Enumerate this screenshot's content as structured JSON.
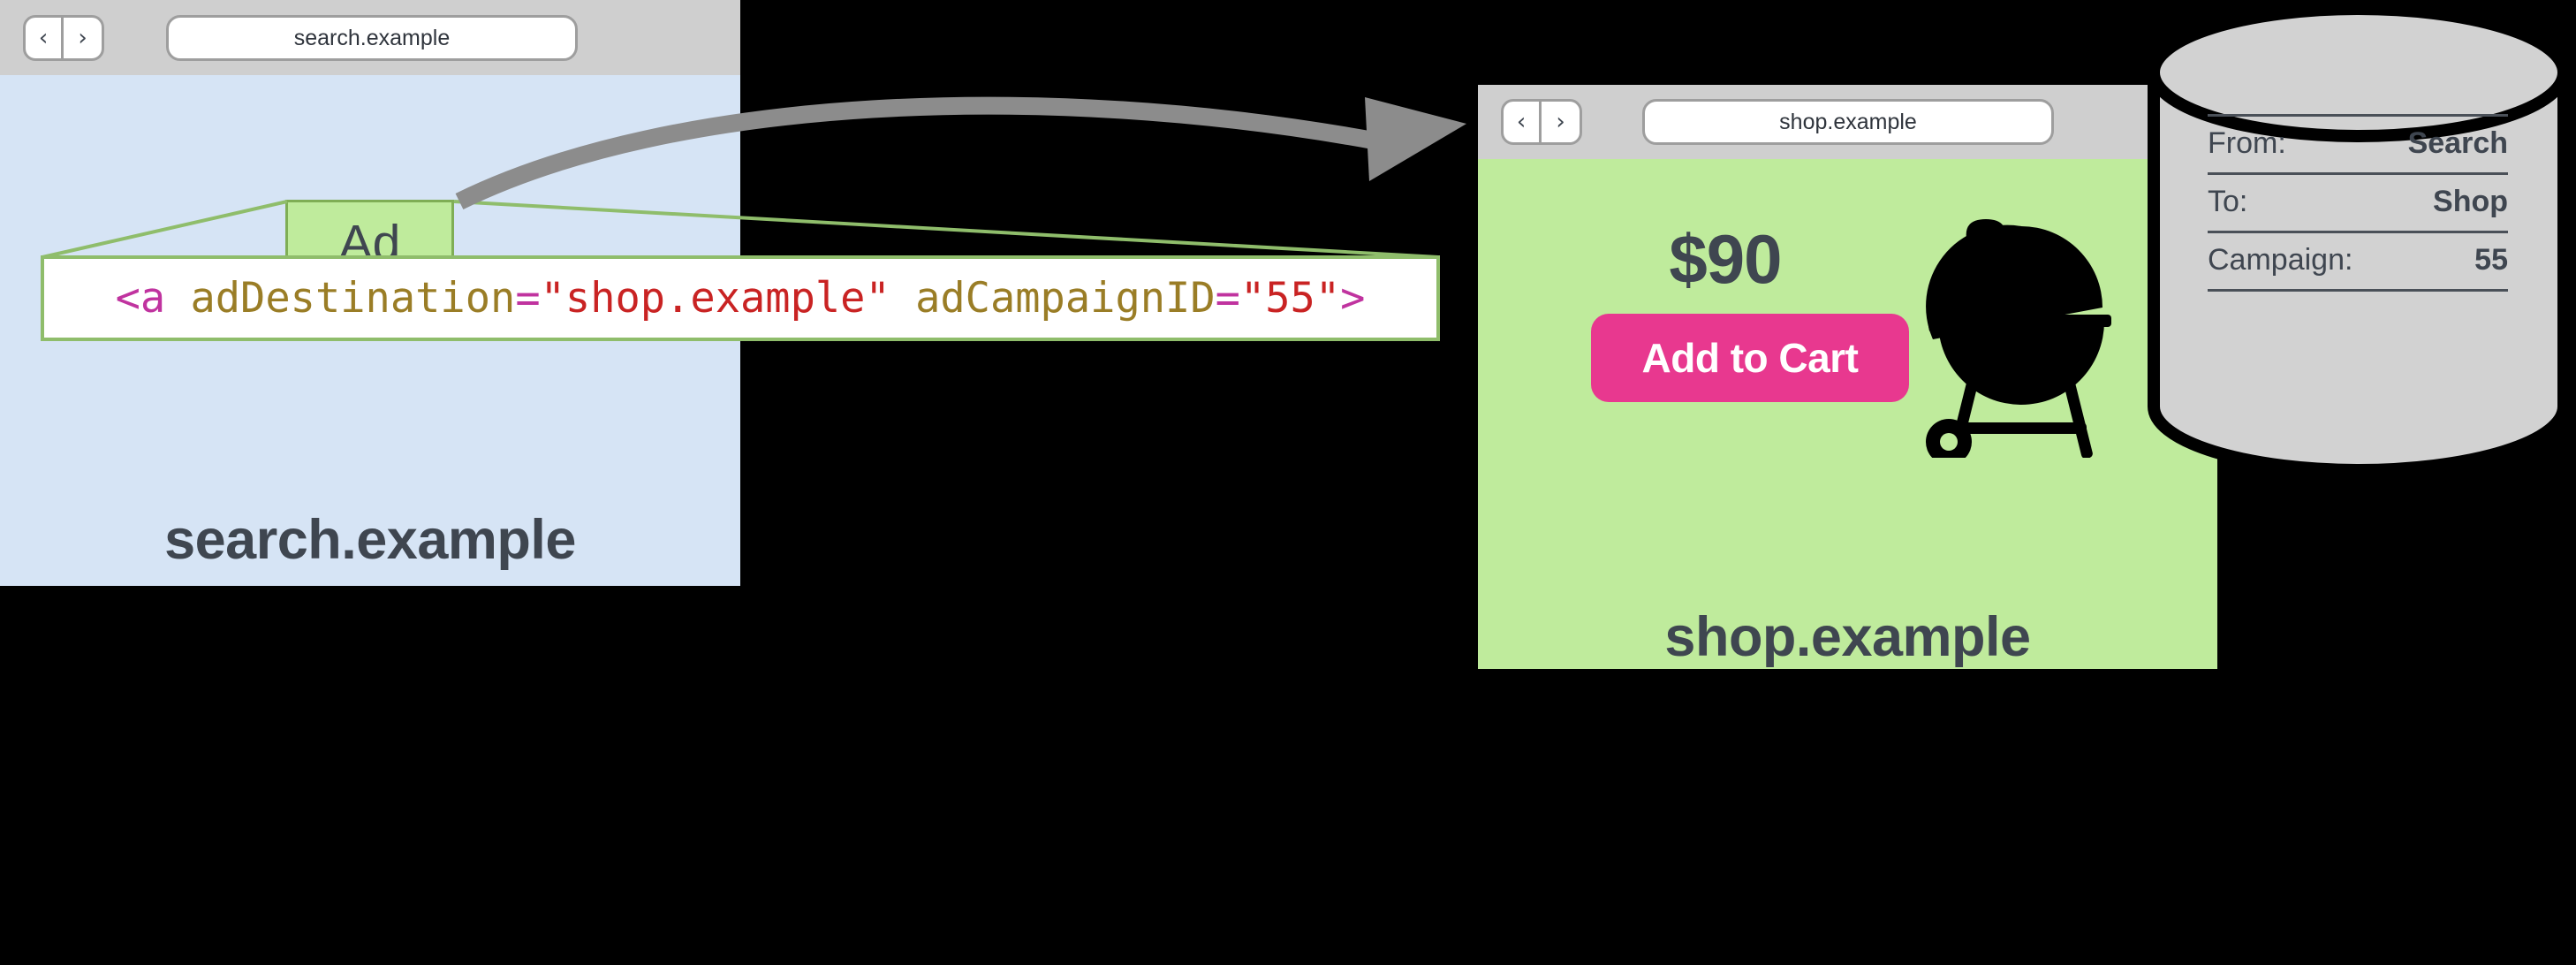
{
  "colors": {
    "page_background": "#000000",
    "chrome_gray": "#cfcfcf",
    "search_page_blue": "#d6e4f5",
    "shop_page_green": "#bfeb9c",
    "ad_green_fill": "#bfeb9c",
    "ad_green_stroke": "#7fae55",
    "callout_line_green": "#8fbd6b",
    "cart_button_pink": "#e8388f",
    "text_dark": "#3f4650",
    "arrow_gray": "#8c8c8c",
    "database_fill": "#d2d2d2",
    "code_tag": "#c0339f",
    "code_attr": "#9a7d26",
    "code_string": "#c92323"
  },
  "search_window": {
    "nav": {
      "back_label": "‹",
      "forward_label": "›"
    },
    "url": "search.example",
    "site_label": "search.example",
    "ad_box_label": "Ad"
  },
  "code_callout": {
    "full_text": "<a adDestination=\"shop.example\" adCampaignID=\"55\">",
    "tokens": [
      {
        "type": "tag",
        "text": "<a "
      },
      {
        "type": "attr",
        "text": "adDestination"
      },
      {
        "type": "eq",
        "text": "="
      },
      {
        "type": "string",
        "text": "\"shop.example\""
      },
      {
        "type": "attr",
        "text": " adCampaignID"
      },
      {
        "type": "eq",
        "text": "="
      },
      {
        "type": "string",
        "text": "\"55\""
      },
      {
        "type": "tag",
        "text": ">"
      }
    ]
  },
  "shop_window": {
    "nav": {
      "back_label": "‹",
      "forward_label": "›"
    },
    "url": "shop.example",
    "site_label": "shop.example",
    "price": "$90",
    "add_to_cart_label": "Add to Cart",
    "product_icon": "bbq-grill-icon"
  },
  "database": {
    "icon": "database-cylinder-icon",
    "rows": [
      {
        "label": "From:",
        "value": "Search"
      },
      {
        "label": "To:",
        "value": "Shop"
      },
      {
        "label": "Campaign:",
        "value": "55"
      }
    ]
  },
  "annotations": {
    "navigation_arrow": "curved-arrow-icon",
    "callout_connector": "callout-lines"
  }
}
